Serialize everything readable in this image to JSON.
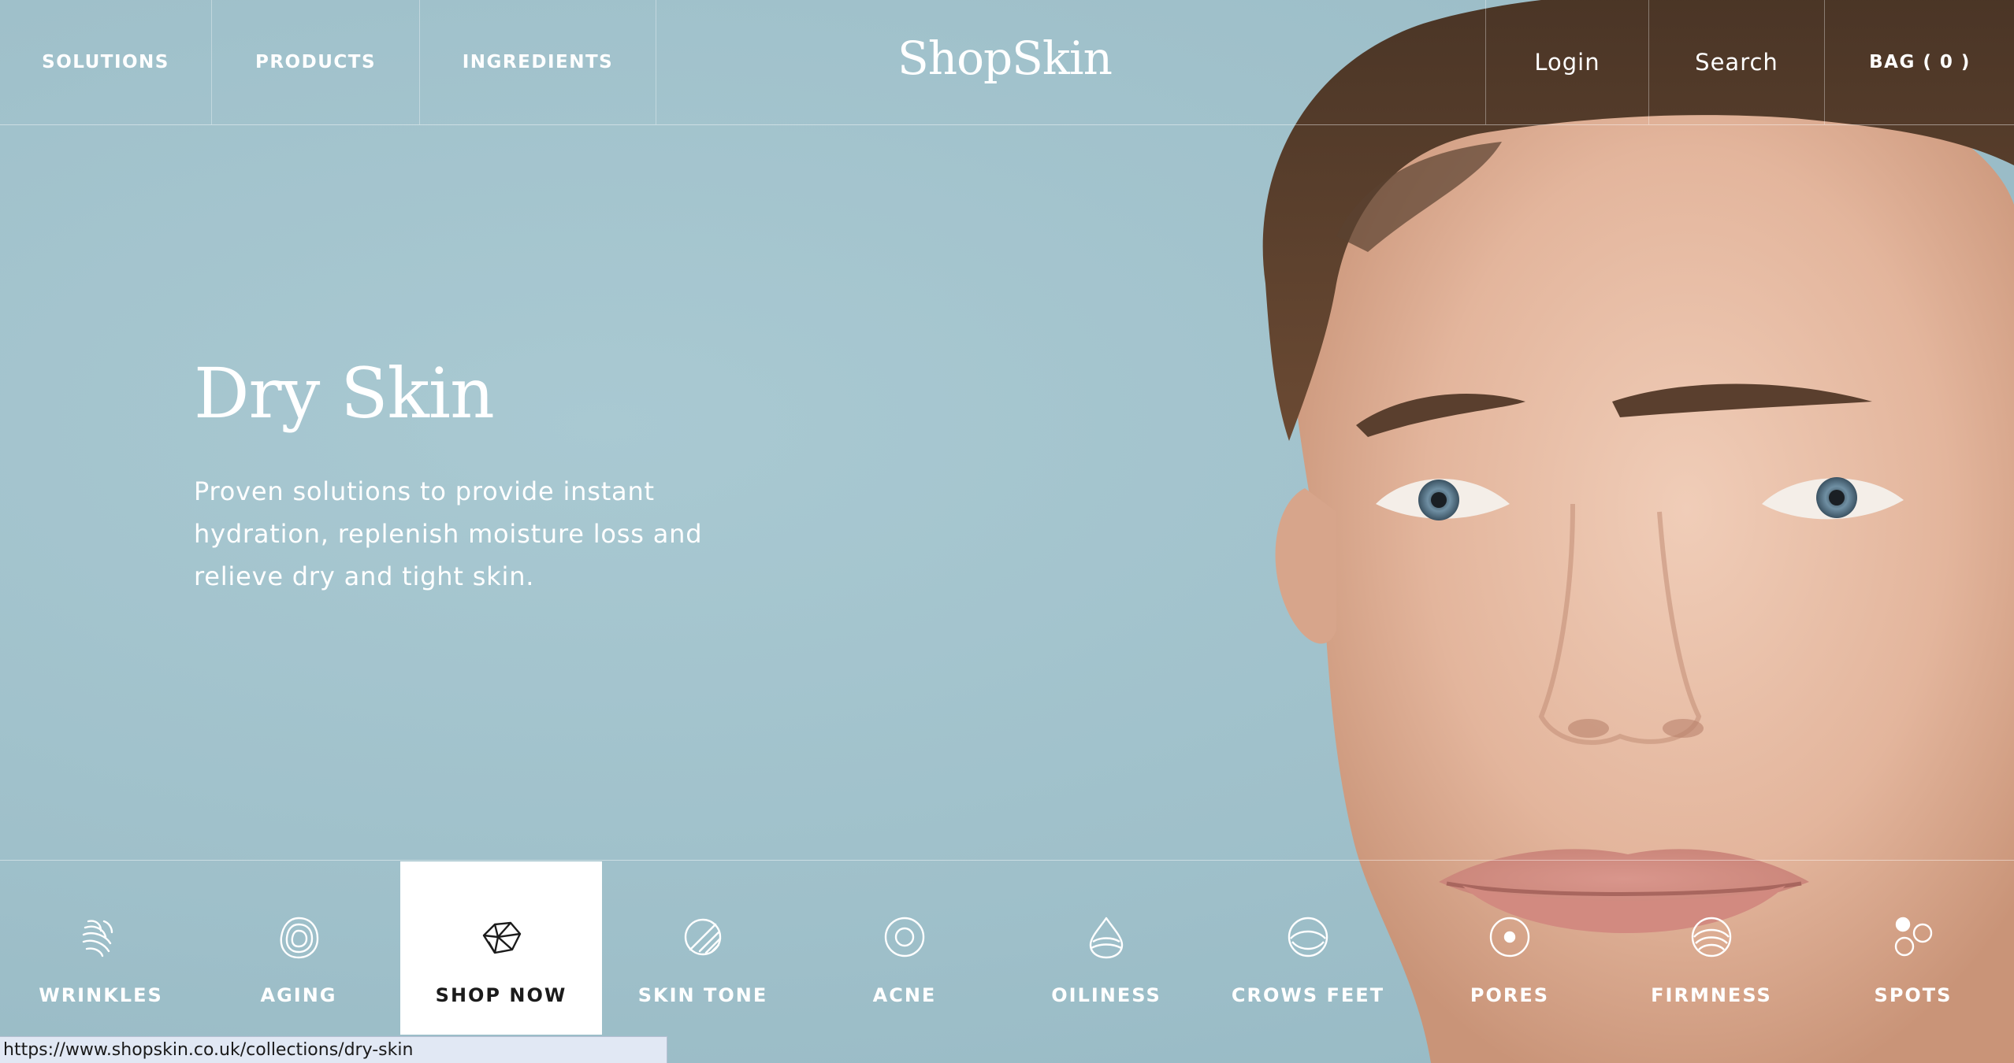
{
  "nav": {
    "left_items": [
      {
        "label": "SOLUTIONS"
      },
      {
        "label": "PRODUCTS"
      },
      {
        "label": "INGREDIENTS"
      }
    ],
    "logo": "ShopSkin",
    "login_label": "Login",
    "search_label": "Search",
    "bag_label": "BAG ( 0 )"
  },
  "hero": {
    "title": "Dry Skin",
    "description": "Proven solutions to provide instant hydration, replenish moisture loss and relieve dry and tight skin."
  },
  "categories": [
    {
      "label": "WRINKLES",
      "icon": "wrinkles-icon"
    },
    {
      "label": "AGING",
      "icon": "aging-icon"
    },
    {
      "label": "SHOP NOW",
      "icon": "gem-icon",
      "active": true
    },
    {
      "label": "SKIN TONE",
      "icon": "skin-tone-icon"
    },
    {
      "label": "ACNE",
      "icon": "acne-icon"
    },
    {
      "label": "OILINESS",
      "icon": "oiliness-icon"
    },
    {
      "label": "CROWS FEET",
      "icon": "crows-feet-icon"
    },
    {
      "label": "PORES",
      "icon": "pores-icon"
    },
    {
      "label": "FIRMNESS",
      "icon": "firmness-icon"
    },
    {
      "label": "SPOTS",
      "icon": "spots-icon"
    }
  ],
  "status_url": "https://www.shopskin.co.uk/collections/dry-skin",
  "colors": {
    "background": "#a3c4cd",
    "text": "#ffffff",
    "active_tab_bg": "#ffffff",
    "active_tab_text": "#1b1b1b"
  }
}
